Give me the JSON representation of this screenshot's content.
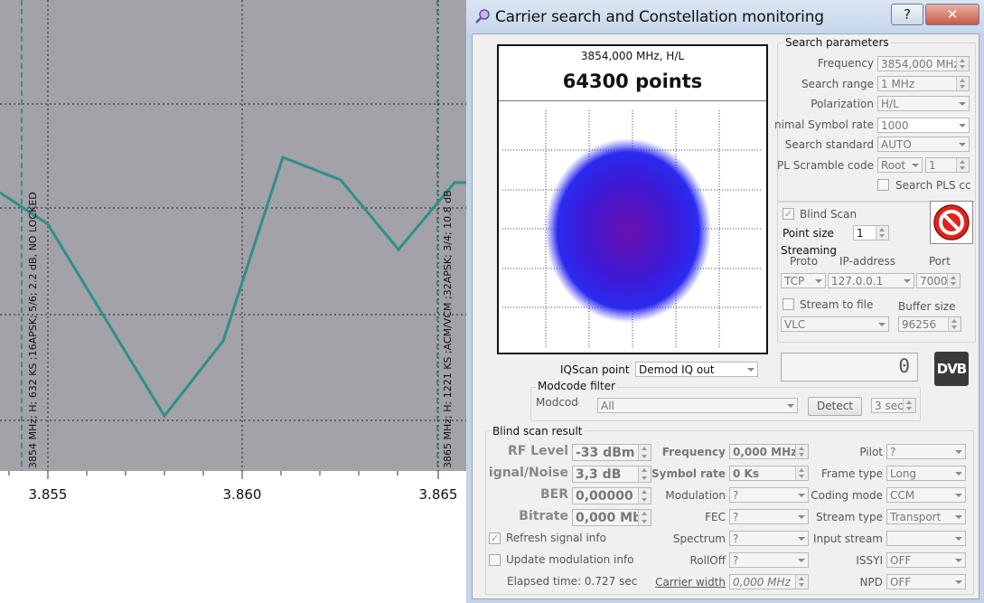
{
  "spectrum": {
    "x_ticks": [
      "3.855",
      "3.860",
      "3.865"
    ],
    "markers": [
      {
        "label": "3854 MHz; H; 632 KS ;16APSK; 5/6; 2.2 dB, NO LOCKED"
      },
      {
        "label": "3865 MHz; H; 1221 KS ;ACM/VCM ;32APSK; 3/4; 10.8 dB"
      }
    ],
    "colors": {
      "background": "#a2a2a8",
      "trace": "#2f8f8a",
      "marker": "#2f7f72"
    }
  },
  "window": {
    "title": "Carrier search and Constellation monitoring",
    "help_label": "?",
    "close_label": "✕"
  },
  "constellation": {
    "freq_label": "3854,000 MHz, H/L",
    "points_label": "64300 points"
  },
  "search_params": {
    "title": "Search parameters",
    "frequency_label": "Frequency",
    "frequency_value": "3854,000 MHz",
    "range_label": "Search range",
    "range_value": "1 MHz",
    "polarization_label": "Polarization",
    "polarization_value": "H/L",
    "min_sr_label": "nimal Symbol rate",
    "min_sr_value": "1000",
    "standard_label": "Search standard",
    "standard_value": "AUTO",
    "pl_label": "PL Scramble code",
    "pl_type": "Root",
    "pl_value": "1",
    "search_pls_label": "Search PLS cc"
  },
  "blind_scan": {
    "label": "Blind Scan",
    "checked": true
  },
  "point_size": {
    "label": "Point size",
    "value": "1"
  },
  "streaming": {
    "title": "Streaming",
    "proto_label": "Proto",
    "ip_label": "IP-address",
    "port_label": "Port",
    "proto_value": "TCP",
    "ip_value": "127.0.0.1",
    "port_value": "7000",
    "stream_file_label": "Stream to file",
    "buffer_label": "Buffer size",
    "player_value": "VLC",
    "buffer_value": "96256"
  },
  "lcd_value": "0",
  "dvb_logo": "DVB",
  "iqscan": {
    "label": "IQScan point",
    "value": "Demod IQ out"
  },
  "modcode": {
    "title": "Modcode filter",
    "label": "Modcode",
    "value": "All",
    "detect_label": "Detect",
    "sec_value": "3 sec"
  },
  "result": {
    "title": "Blind scan result",
    "rf_label": "RF Level",
    "rf_value": "-33 dBm",
    "sn_label": "ignal/Noise",
    "sn_value": "3,3 dB",
    "ber_label": "BER",
    "ber_value": "0,00000",
    "bitrate_label": "Bitrate",
    "bitrate_value": "0,000 Mb",
    "freq_label": "Frequency",
    "freq_value": "0,000 MHz",
    "sr_label": "Symbol rate",
    "sr_value": "0 Ks",
    "mod_label": "Modulation",
    "mod_value": "?",
    "fec_label": "FEC",
    "fec_value": "?",
    "spectrum_label": "Spectrum",
    "spectrum_value": "?",
    "rolloff_label": "RollOff",
    "rolloff_value": "?",
    "pilot_label": "Pilot",
    "pilot_value": "?",
    "frame_label": "Frame type",
    "frame_value": "Long",
    "coding_label": "Coding mode",
    "coding_value": "CCM",
    "stream_type_label": "Stream type",
    "stream_type_value": "Transport",
    "input_stream_label": "Input stream",
    "input_stream_value": "",
    "issyi_label": "ISSYI",
    "issyi_value": "OFF",
    "npd_label": "NPD",
    "npd_value": "OFF",
    "refresh_label": "Refresh signal info",
    "refresh_checked": true,
    "update_label": "Update modulation info",
    "update_checked": false,
    "elapsed_label": "Elapsed time: 0.727 sec",
    "carrier_width_label": "Carrier width",
    "carrier_width_value": "0,000 MHz"
  }
}
